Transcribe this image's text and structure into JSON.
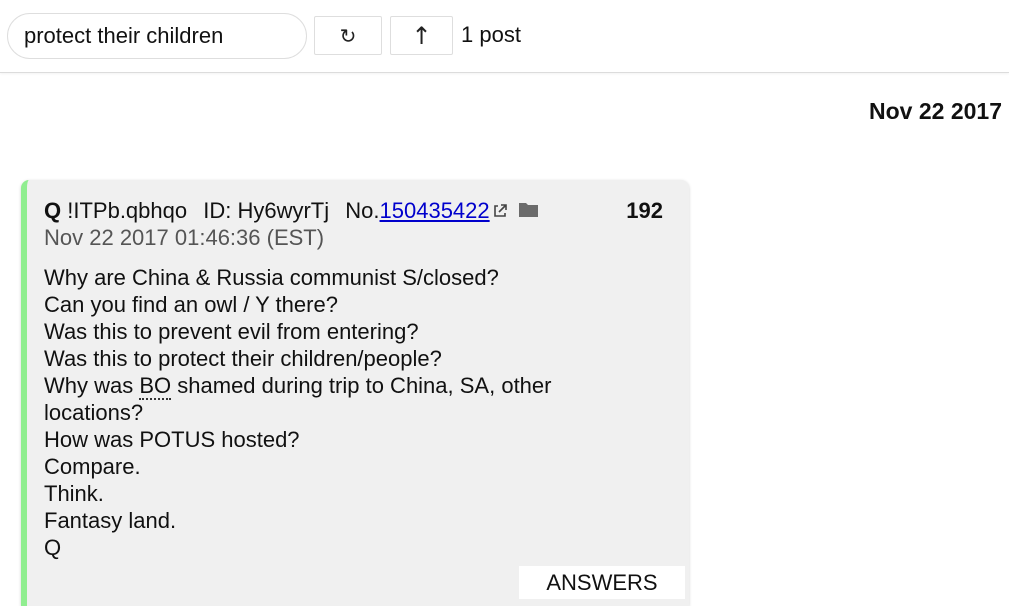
{
  "toolbar": {
    "search_value": "protect their children",
    "refresh_glyph": "↻",
    "up_glyph": "↑",
    "post_count": "1 post"
  },
  "date_heading": "Nov 22 2017",
  "post": {
    "author": "Q",
    "tripcode": "!ITPb.qbhqo",
    "id_label": "ID: Hy6wyrTj",
    "no_label": "No.",
    "post_id": "150435422",
    "number": "192",
    "timestamp": "Nov 22 2017 01:46:36 (EST)",
    "lines": {
      "l1": "Why are China & Russia communist S/closed?",
      "l2": "Can you find an owl / Y there?",
      "l3": "Was this to prevent evil from entering?",
      "l4": "Was this to protect their children/people?",
      "l5_pre": "Why was ",
      "l5_abbr": "BO",
      "l5_post": " shamed during trip to China, SA, other",
      "l6": "locations?",
      "l7": "How was POTUS hosted?",
      "l8": "Compare.",
      "l9": "Think.",
      "l10": "Fantasy land.",
      "l11": "Q"
    },
    "answers_label": "ANSWERS",
    "accent_color": "#90ee90",
    "icons": [
      "external-link-icon",
      "folder-icon"
    ]
  }
}
